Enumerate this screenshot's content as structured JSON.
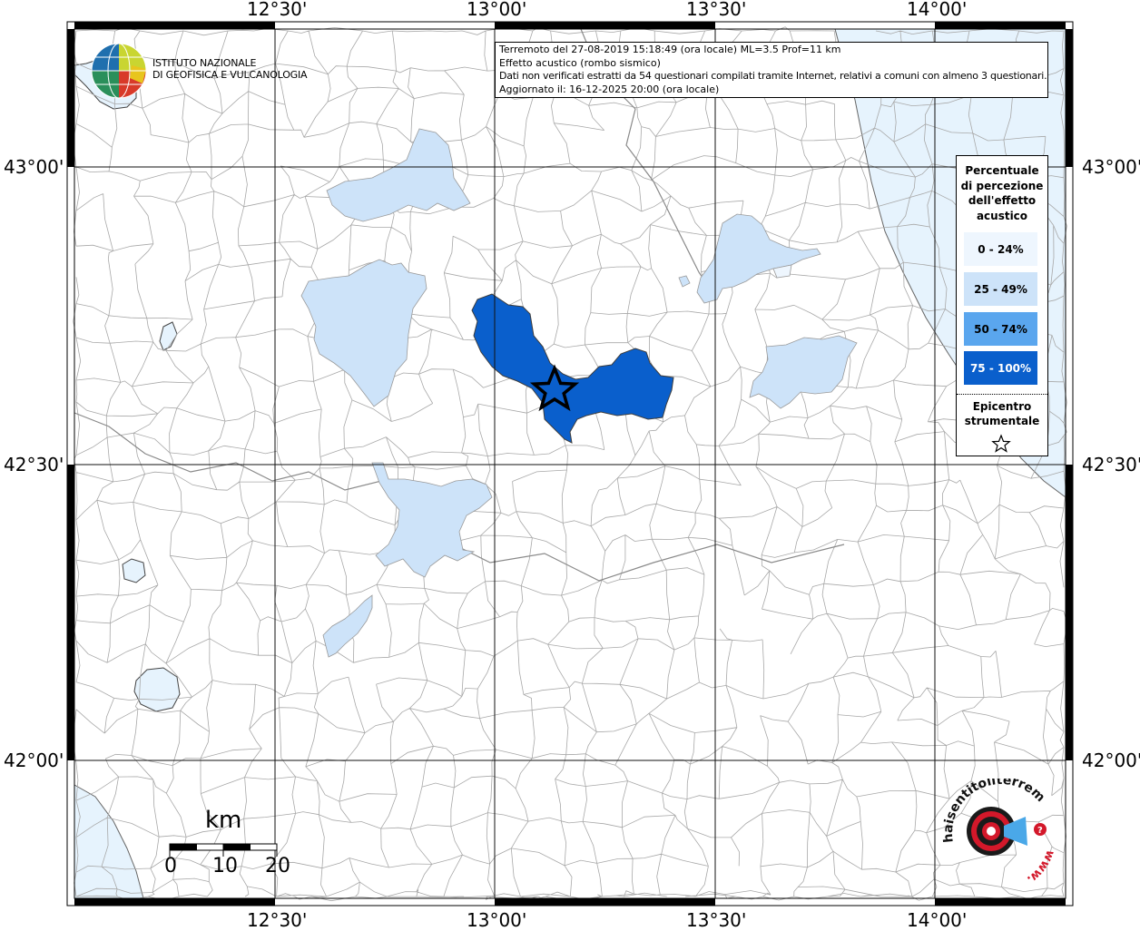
{
  "header": {
    "lines": [
      "Terremoto del 27-08-2019 15:18:49 (ora locale) ML=3.5 Prof=11 km",
      "Effetto acustico (rombo sismico)",
      "Dati non verificati estratti da 54 questionari compilati tramite Internet, relativi a comuni con almeno 3 questionari.",
      "Aggiornato il: 16-12-2025 20:00 (ora locale)"
    ]
  },
  "institute": {
    "line1": "ISTITUTO NAZIONALE",
    "line2": "DI GEOFISICA E VULCANOLOGIA"
  },
  "axes": {
    "longitudes": [
      "12°30'",
      "13°00'",
      "13°30'",
      "14°00'"
    ],
    "latitudes": [
      "43°00'",
      "42°30'",
      "42°00'"
    ]
  },
  "legend": {
    "title_lines": [
      "Percentuale",
      "di percezione",
      "dell'effetto",
      "acustico"
    ],
    "items": [
      {
        "label": "0 - 24%",
        "color": "#eef6fe"
      },
      {
        "label": "25 - 49%",
        "color": "#cde3f9"
      },
      {
        "label": "50 - 74%",
        "color": "#5aa6ee"
      },
      {
        "label": "75 - 100%",
        "color": "#0a5fcc"
      }
    ],
    "epicenter_lines": [
      "Epicentro",
      "strumentale"
    ],
    "epicenter_icon": "star-outline-icon"
  },
  "scale": {
    "unit": "km",
    "ticks": [
      "0",
      "10",
      "20"
    ]
  },
  "brand": {
    "text": "haisentitoilterremoto.it",
    "www": "www.",
    "icon": "target-megaphone-icon",
    "accent": "#e2001a"
  },
  "colors": {
    "sea": "#e6f3fd",
    "strong": "#0a5fcc",
    "light": "#cde3f9",
    "border": "#a8a8a8"
  }
}
